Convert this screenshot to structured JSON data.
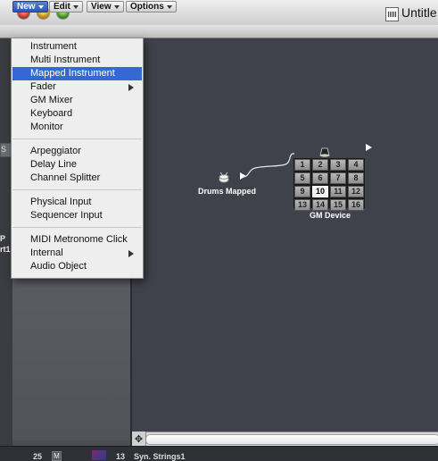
{
  "window": {
    "title": "Untitle"
  },
  "menubar": [
    {
      "label": "New"
    },
    {
      "label": "Edit"
    },
    {
      "label": "View"
    },
    {
      "label": "Options"
    }
  ],
  "new_menu": {
    "groups": [
      [
        {
          "label": "Instrument"
        },
        {
          "label": "Multi Instrument"
        },
        {
          "label": "Mapped Instrument",
          "selected": true
        },
        {
          "label": "Fader",
          "submenu": true
        },
        {
          "label": "GM Mixer"
        },
        {
          "label": "Keyboard"
        },
        {
          "label": "Monitor"
        }
      ],
      [
        {
          "label": "Arpeggiator"
        },
        {
          "label": "Delay Line"
        },
        {
          "label": "Channel Splitter"
        }
      ],
      [
        {
          "label": "Physical Input"
        },
        {
          "label": "Sequencer Input"
        }
      ],
      [
        {
          "label": "MIDI Metronome Click"
        },
        {
          "label": "Internal",
          "submenu": true
        },
        {
          "label": "Audio Object"
        }
      ]
    ]
  },
  "background_fragments": {
    "left_top": "S",
    "left_mid1": "P",
    "left_mid2": "rt1"
  },
  "canvas": {
    "objects": {
      "drums": {
        "label": "Drums Mapped",
        "icon": "drum-icon"
      },
      "gm_device": {
        "label": "GM Device",
        "icon": "speaker-icon",
        "channels": [
          "1",
          "2",
          "3",
          "4",
          "5",
          "6",
          "7",
          "8",
          "9",
          "10",
          "11",
          "12",
          "13",
          "14",
          "15",
          "16"
        ],
        "highlighted_channel": "10"
      }
    }
  },
  "track_row": {
    "number": "25",
    "mute": "M",
    "channel": "13",
    "name": "Syn. Strings1"
  },
  "colors": {
    "selection": "#3568d4",
    "canvas": "#3f424a"
  }
}
